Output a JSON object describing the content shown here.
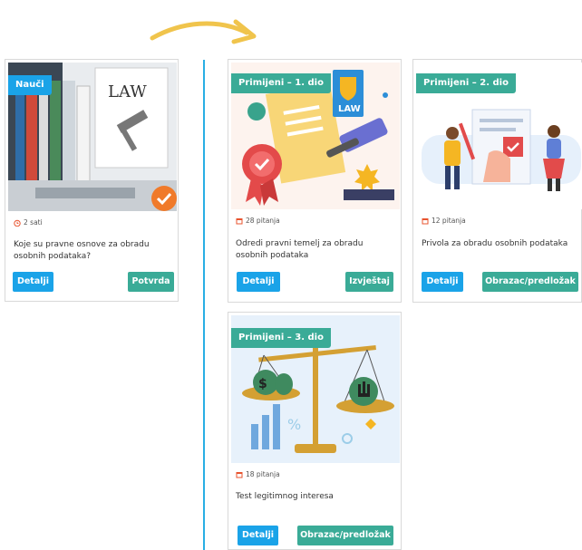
{
  "colors": {
    "accent_blue": "#1aa3e8",
    "accent_teal": "#3aab97",
    "divider": "#29aee4",
    "arrow": "#f0c44c",
    "meta_icon": "#e8542f"
  },
  "cards": [
    {
      "badge": "Nauči",
      "meta_icon": "timer-icon",
      "meta": "2 sati",
      "title": "Koje su pravne osnove za obradu osobnih podataka?",
      "buttons": [
        "Detalji",
        "Potvrda"
      ]
    },
    {
      "badge": "Primijeni – 1. dio",
      "meta_icon": "calendar-icon",
      "meta": "28 pitanja",
      "title": "Odredi pravni temelj za obradu osobnih podataka",
      "buttons": [
        "Detalji",
        "Izvještaj"
      ]
    },
    {
      "badge": "Primijeni – 2. dio",
      "meta_icon": "calendar-icon",
      "meta": "12 pitanja",
      "title": "Privola za obradu osobnih podataka",
      "buttons": [
        "Detalji",
        "Obrazac/predložak"
      ]
    },
    {
      "badge": "Primijeni – 3. dio",
      "meta_icon": "calendar-icon",
      "meta": "18 pitanja",
      "title": "Test legitimnog interesa",
      "buttons": [
        "Detalji",
        "Obrazac/predložak"
      ]
    }
  ],
  "illustration_text": {
    "law_binder": "LAW",
    "law_book": "LAW"
  }
}
